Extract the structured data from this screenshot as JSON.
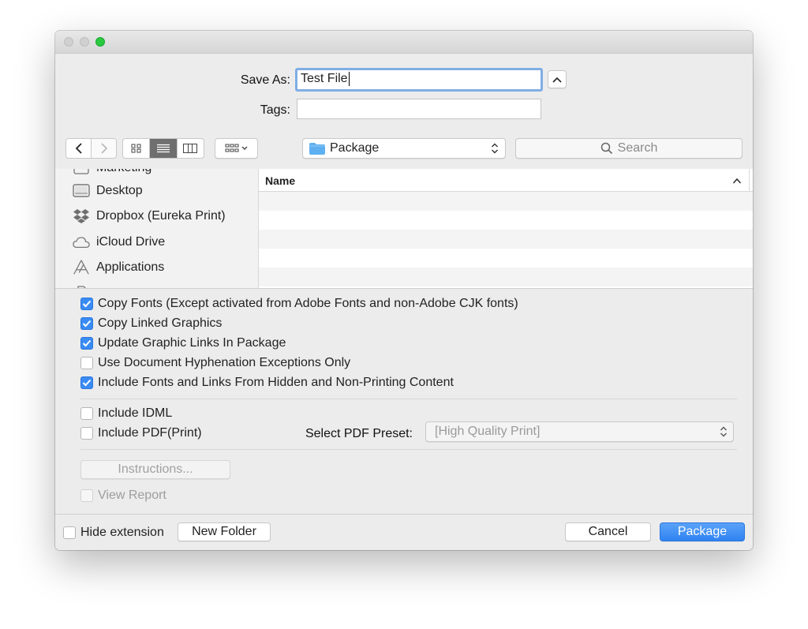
{
  "dialog": {
    "save_as_label": "Save As:",
    "save_as_value": "Test File",
    "tags_label": "Tags:",
    "tags_value": ""
  },
  "toolbar": {
    "location": "Package",
    "search_placeholder": "Search"
  },
  "sidebar": {
    "items": [
      {
        "label": "Marketing",
        "icon": "folder-icon"
      },
      {
        "label": "Desktop",
        "icon": "desktop-icon"
      },
      {
        "label": "Dropbox (Eureka Print)",
        "icon": "dropbox-icon"
      },
      {
        "label": "iCloud Drive",
        "icon": "cloud-icon"
      },
      {
        "label": "Applications",
        "icon": "applications-icon"
      }
    ]
  },
  "file_list": {
    "column_name": "Name",
    "sort_indicator": "^",
    "rows": []
  },
  "options": {
    "copy_fonts": {
      "label": "Copy Fonts (Except activated from Adobe Fonts and non-Adobe CJK fonts)",
      "checked": true
    },
    "copy_linked_graphics": {
      "label": "Copy Linked Graphics",
      "checked": true
    },
    "update_graphic_links": {
      "label": "Update Graphic Links In Package",
      "checked": true
    },
    "use_hyphenation": {
      "label": "Use Document Hyphenation Exceptions Only",
      "checked": false
    },
    "include_hidden": {
      "label": "Include Fonts and Links From Hidden and Non-Printing Content",
      "checked": true
    },
    "include_idml": {
      "label": "Include IDML",
      "checked": false
    },
    "include_pdf": {
      "label": "Include PDF(Print)",
      "checked": false
    },
    "pdf_preset_label": "Select PDF Preset:",
    "pdf_preset_value": "[High Quality Print]",
    "instructions_button": "Instructions...",
    "view_report": {
      "label": "View Report",
      "checked": false,
      "disabled": true
    }
  },
  "footer": {
    "hide_extension": "Hide extension",
    "new_folder": "New Folder",
    "cancel": "Cancel",
    "primary": "Package"
  },
  "colors": {
    "accent": "#3a8bf4",
    "window_bg": "#ececec",
    "primary_button": "#3e8ff5"
  }
}
